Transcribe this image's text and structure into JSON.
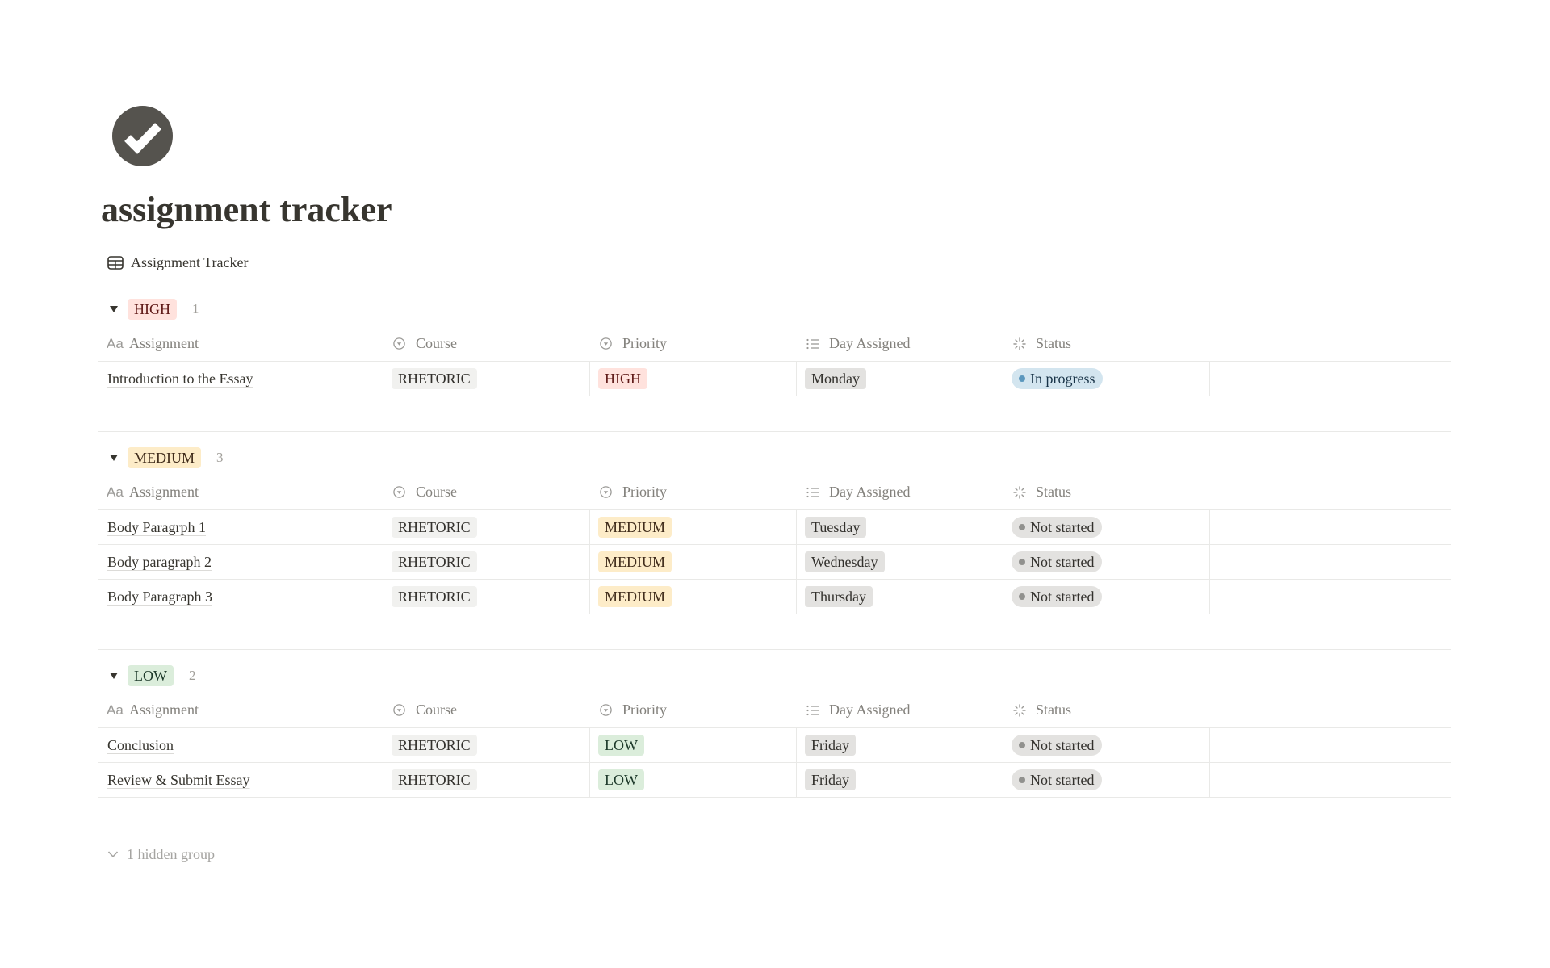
{
  "page": {
    "icon": "check-circle-icon",
    "title": "assignment tracker"
  },
  "view": {
    "icon": "table-icon",
    "label": "Assignment Tracker"
  },
  "columns": [
    {
      "key": "assignment",
      "label": "Assignment",
      "icon": "text-property-icon"
    },
    {
      "key": "course",
      "label": "Course",
      "icon": "select-property-icon"
    },
    {
      "key": "priority",
      "label": "Priority",
      "icon": "select-property-icon"
    },
    {
      "key": "day_assigned",
      "label": "Day Assigned",
      "icon": "multi-select-property-icon"
    },
    {
      "key": "status",
      "label": "Status",
      "icon": "status-property-icon"
    }
  ],
  "groups": [
    {
      "label": "HIGH",
      "count": "1",
      "rows": [
        {
          "assignment": "Introduction to the Essay",
          "course": "RHETORIC",
          "priority": "HIGH",
          "day_assigned": "Monday",
          "status": "In progress"
        }
      ]
    },
    {
      "label": "MEDIUM",
      "count": "3",
      "rows": [
        {
          "assignment": "Body Paragrph 1",
          "course": "RHETORIC",
          "priority": "MEDIUM",
          "day_assigned": "Tuesday",
          "status": "Not started"
        },
        {
          "assignment": "Body paragraph 2",
          "course": "RHETORIC",
          "priority": "MEDIUM",
          "day_assigned": "Wednesday",
          "status": "Not started"
        },
        {
          "assignment": "Body Paragraph 3",
          "course": "RHETORIC",
          "priority": "MEDIUM",
          "day_assigned": "Thursday",
          "status": "Not started"
        }
      ]
    },
    {
      "label": "LOW",
      "count": "2",
      "rows": [
        {
          "assignment": "Conclusion",
          "course": "RHETORIC",
          "priority": "LOW",
          "day_assigned": "Friday",
          "status": "Not started"
        },
        {
          "assignment": "Review & Submit Essay",
          "course": "RHETORIC",
          "priority": "LOW",
          "day_assigned": "Friday",
          "status": "Not started"
        }
      ]
    }
  ],
  "hidden_groups_label": "1 hidden group",
  "colors": {
    "text": "#37352f",
    "icon_bg": "#55534e",
    "priority": {
      "HIGH": {
        "bg": "#ffe2dd",
        "fg": "#5d1715"
      },
      "MEDIUM": {
        "bg": "#fdecc8",
        "fg": "#402c1b"
      },
      "LOW": {
        "bg": "#dbeddb",
        "fg": "#1c3829"
      }
    },
    "course": {
      "RHETORIC": {
        "bg": "#f1f1ef",
        "fg": "#32302c"
      }
    },
    "day": {
      "bg": "#e3e2e0",
      "fg": "#32302c"
    },
    "status": {
      "in_progress": {
        "bg": "#d3e5ef",
        "fg": "#183347",
        "dot": "#5b97bd"
      },
      "not_started": {
        "bg": "#e3e2e0",
        "fg": "#32302c",
        "dot": "#91918e"
      }
    }
  }
}
